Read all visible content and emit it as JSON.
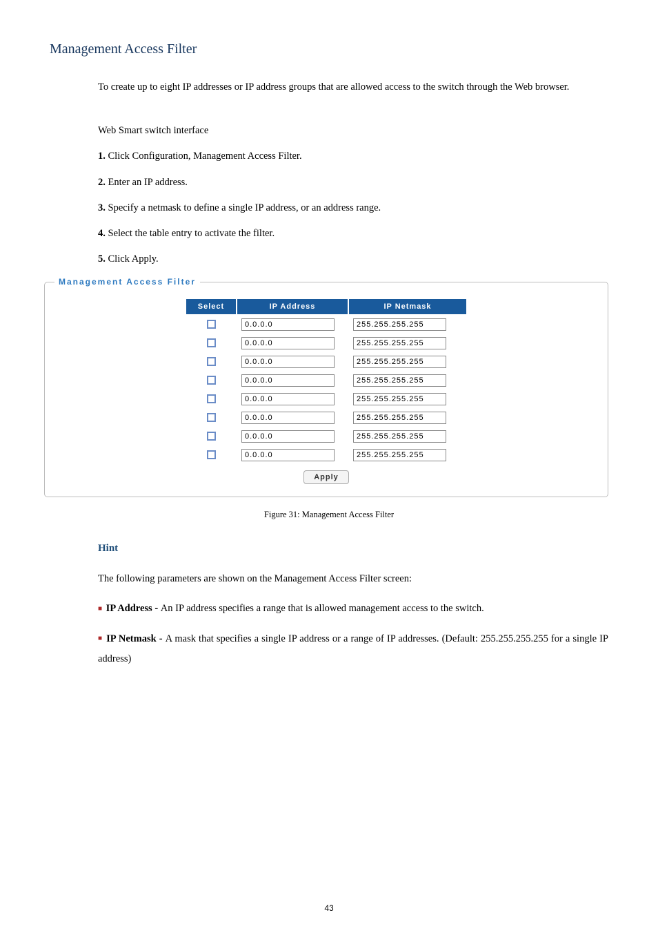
{
  "title": "Management Access Filter",
  "intro": "To create up to eight IP addresses or IP address groups that are allowed access to the switch through the Web browser.",
  "interfaceLine": "Web Smart switch interface",
  "steps": [
    {
      "num": "1.",
      "text": " Click Configuration, Management Access Filter."
    },
    {
      "num": "2.",
      "text": " Enter an IP address."
    },
    {
      "num": "3.",
      "text": " Specify a netmask to define a single IP address, or an address range."
    },
    {
      "num": "4.",
      "text": " Select the table entry to activate the filter."
    },
    {
      "num": "5.",
      "text": " Click Apply."
    }
  ],
  "fieldset": {
    "legend": "Management Access Filter",
    "headers": {
      "select": "Select",
      "ip": "IP Address",
      "netmask": "IP Netmask"
    },
    "rows": [
      {
        "ip": "0.0.0.0",
        "netmask": "255.255.255.255"
      },
      {
        "ip": "0.0.0.0",
        "netmask": "255.255.255.255"
      },
      {
        "ip": "0.0.0.0",
        "netmask": "255.255.255.255"
      },
      {
        "ip": "0.0.0.0",
        "netmask": "255.255.255.255"
      },
      {
        "ip": "0.0.0.0",
        "netmask": "255.255.255.255"
      },
      {
        "ip": "0.0.0.0",
        "netmask": "255.255.255.255"
      },
      {
        "ip": "0.0.0.0",
        "netmask": "255.255.255.255"
      },
      {
        "ip": "0.0.0.0",
        "netmask": "255.255.255.255"
      }
    ],
    "apply": "Apply"
  },
  "caption": "Figure 31: Management Access Filter",
  "hint": {
    "heading": "Hint",
    "lead": "The following parameters are shown on the Management Access Filter screen:",
    "items": [
      {
        "label": "IP Address - ",
        "desc": "An IP address specifies a range that is allowed management access to the switch."
      },
      {
        "label": "IP Netmask - ",
        "desc": "A mask that specifies a single IP address or a range of IP addresses. (Default: 255.255.255.255 for a single IP address)"
      }
    ]
  },
  "pageNumber": "43"
}
